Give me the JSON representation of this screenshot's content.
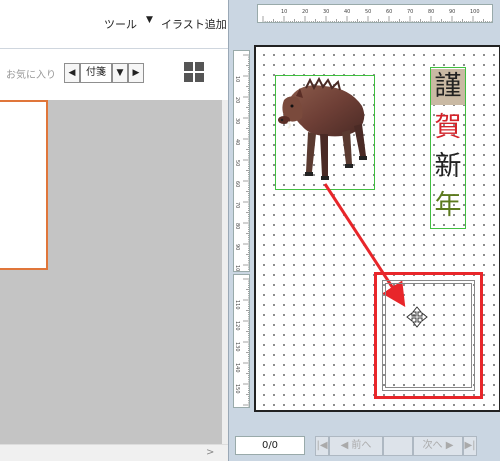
{
  "menu": {
    "tools": "ツール",
    "dropdown_arrow": "▼",
    "add_illustration": "イラスト追加"
  },
  "toolbar": {
    "favorites_label": "お気に入り",
    "prev_arrow": "◀",
    "category_value": "付箋",
    "dropdown_arrow": "▼",
    "next_arrow": "▶",
    "grid_icon": "grid-view-icon"
  },
  "ruler": {
    "horizontal_labels": [
      "10",
      "20",
      "30",
      "40",
      "50",
      "60",
      "70",
      "80",
      "90",
      "100"
    ],
    "vertical_labels_top": [
      "10",
      "20",
      "30",
      "40",
      "50",
      "60",
      "70",
      "80",
      "90",
      "100"
    ],
    "vertical_labels_bottom": [
      "110",
      "120",
      "130",
      "140",
      "150"
    ]
  },
  "canvas": {
    "boar_image": "wild-boar-illustration",
    "kanji": [
      "謹",
      "賀",
      "新",
      "年"
    ],
    "kanji_colors": [
      "#222222",
      "#d4232a",
      "#222222",
      "#5c7a1e"
    ],
    "arrow_color": "#e8262a",
    "frame_color": "#3fbf3f"
  },
  "status": {
    "page_counter": "0/0",
    "first_icon": "|◀",
    "prev_page": "◀ 前へ",
    "next_page": "次へ ▶",
    "last_icon": "▶|"
  }
}
